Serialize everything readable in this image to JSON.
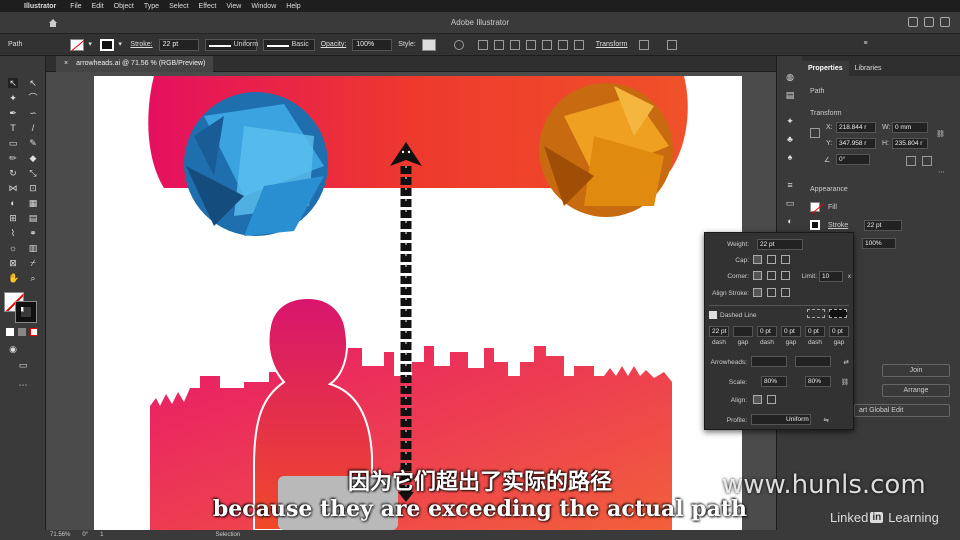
{
  "menubar": {
    "app": "Illustrator",
    "items": [
      "File",
      "Edit",
      "Object",
      "Type",
      "Select",
      "Effect",
      "View",
      "Window",
      "Help"
    ]
  },
  "window": {
    "title": "Adobe Illustrator"
  },
  "control_bar": {
    "path_label": "Path",
    "stroke_label": "Stroke:",
    "stroke_weight": "22 pt",
    "profile": "Uniform",
    "brush": "Basic",
    "opacity_label": "Opacity:",
    "opacity_value": "100%",
    "style_label": "Style:",
    "transform_label": "Transform"
  },
  "document": {
    "tab_title": "arrowheads.ai @ 71.56 % (RGB/Preview)"
  },
  "properties": {
    "tabs": [
      "Properties",
      "Libraries"
    ],
    "selection": "Path",
    "transform_title": "Transform",
    "x_label": "X:",
    "x_value": "218.844 r",
    "y_label": "Y:",
    "y_value": "347.958 r",
    "w_label": "W:",
    "w_value": "0 mm",
    "h_label": "H:",
    "h_value": "235.804 r",
    "angle_value": "0°",
    "appearance_title": "Appearance",
    "fill_label": "Fill",
    "stroke_label": "Stroke",
    "stroke_value": "22 pt",
    "opacity_value": "100%",
    "join_button": "Join",
    "arrange_button": "Arrange",
    "global_edit_button": "art Global Edit"
  },
  "stroke_panel": {
    "weight_label": "Weight:",
    "weight_value": "22 pt",
    "cap_label": "Cap:",
    "corner_label": "Corner:",
    "limit_label": "Limit:",
    "limit_value": "10",
    "limit_unit": "x",
    "align_label": "Align Stroke:",
    "dashed_label": "Dashed Line",
    "dash_values": [
      "22 pt",
      "",
      "0 pt",
      "0 pt",
      "0 pt",
      "0 pt"
    ],
    "dash_labels": [
      "dash",
      "gap",
      "dash",
      "gap",
      "dash",
      "gap"
    ],
    "arrowheads_label": "Arrowheads:",
    "scale_label": "Scale:",
    "scale_start": "80%",
    "scale_end": "80%",
    "align_arrow_label": "Align:",
    "profile_label": "Profile:",
    "profile_value": "Uniform"
  },
  "status": {
    "zoom": "71.56%",
    "angle": "0°",
    "artboard": "1",
    "mode": "Selection"
  },
  "subtitles": {
    "chinese": "因为它们超出了实际的路径",
    "english": "because they are exceeding the actual path"
  },
  "watermark": "www.hunls.com",
  "brand": {
    "linked": "Linked",
    "in": "in",
    "learning": "Learning"
  },
  "colors": {
    "accent_pink": "#e0185e",
    "accent_orange": "#f05a1c",
    "blue_circle": "#2a8fd0",
    "orange_circle": "#e08a10"
  }
}
